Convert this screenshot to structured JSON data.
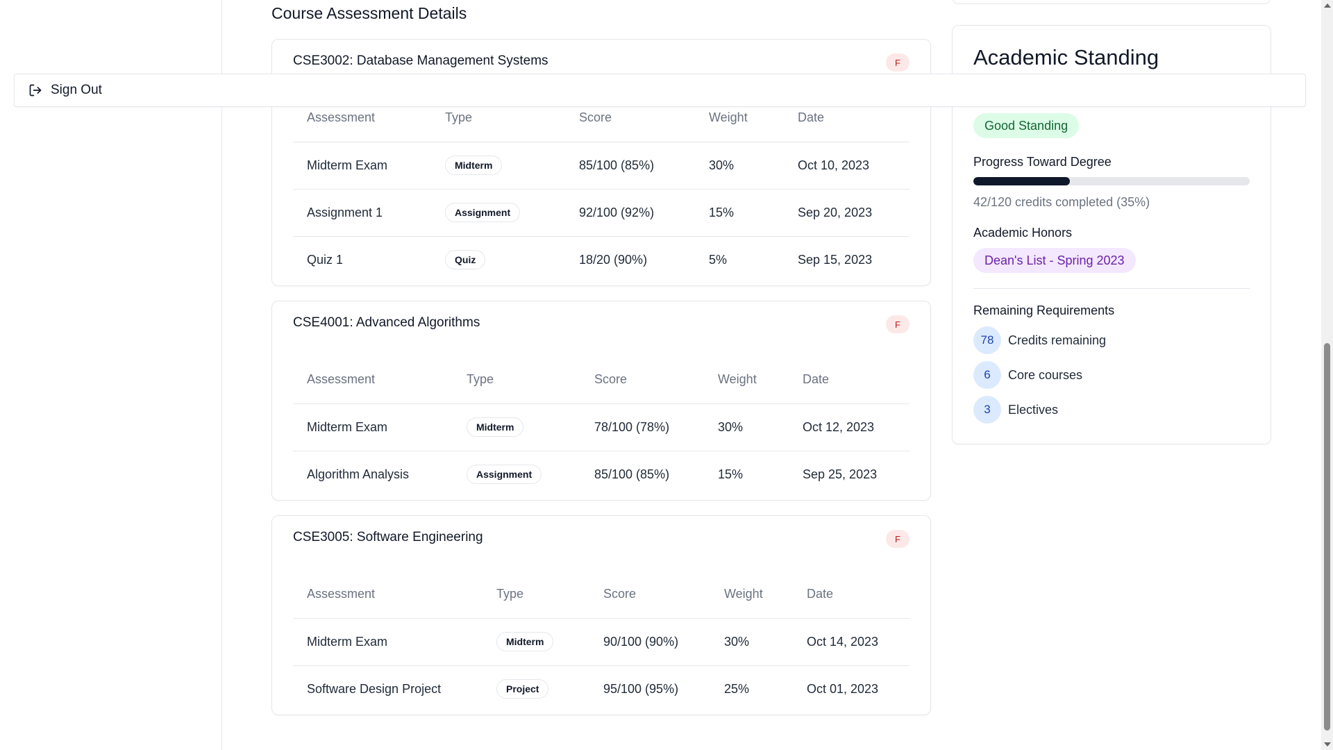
{
  "sign_out": {
    "label": "Sign Out",
    "icon": "sign-out-icon"
  },
  "main": {
    "section_title": "Course Assessment Details",
    "columns": [
      "Assessment",
      "Type",
      "Score",
      "Weight",
      "Date"
    ],
    "courses": [
      {
        "title": "CSE3002: Database Management Systems",
        "grade": "F",
        "rows": [
          {
            "assessment": "Midterm Exam",
            "type": "Midterm",
            "score": "85/100 (85%)",
            "weight": "30%",
            "date": "Oct 10, 2023"
          },
          {
            "assessment": "Assignment 1",
            "type": "Assignment",
            "score": "92/100 (92%)",
            "weight": "15%",
            "date": "Sep 20, 2023"
          },
          {
            "assessment": "Quiz 1",
            "type": "Quiz",
            "score": "18/20 (90%)",
            "weight": "5%",
            "date": "Sep 15, 2023"
          }
        ]
      },
      {
        "title": "CSE4001: Advanced Algorithms",
        "grade": "F",
        "rows": [
          {
            "assessment": "Midterm Exam",
            "type": "Midterm",
            "score": "78/100 (78%)",
            "weight": "30%",
            "date": "Oct 12, 2023"
          },
          {
            "assessment": "Algorithm Analysis",
            "type": "Assignment",
            "score": "85/100 (85%)",
            "weight": "15%",
            "date": "Sep 25, 2023"
          }
        ]
      },
      {
        "title": "CSE3005: Software Engineering",
        "grade": "F",
        "rows": [
          {
            "assessment": "Midterm Exam",
            "type": "Midterm",
            "score": "90/100 (90%)",
            "weight": "30%",
            "date": "Oct 14, 2023"
          },
          {
            "assessment": "Software Design Project",
            "type": "Project",
            "score": "95/100 (95%)",
            "weight": "25%",
            "date": "Oct 01, 2023"
          }
        ]
      }
    ]
  },
  "standing": {
    "title": "Academic Standing",
    "status": "Good Standing",
    "progress_label": "Progress Toward Degree",
    "progress_fraction": 0.35,
    "progress_text": "42/120 credits completed (35%)",
    "honors_label": "Academic Honors",
    "honor": "Dean's List - Spring 2023",
    "requirements_label": "Remaining Requirements",
    "requirements": [
      {
        "count": "78",
        "label": "Credits remaining"
      },
      {
        "count": "6",
        "label": "Core courses"
      },
      {
        "count": "3",
        "label": "Electives"
      }
    ]
  },
  "colors": {
    "grade_badge_bg": "#fde8e8",
    "grade_badge_text": "#b91c1c",
    "standing_bg": "#dcfce7",
    "standing_text": "#166534",
    "honor_bg": "#f3e8ff",
    "honor_text": "#6b21a8",
    "progress_fill": "#0f172a"
  }
}
